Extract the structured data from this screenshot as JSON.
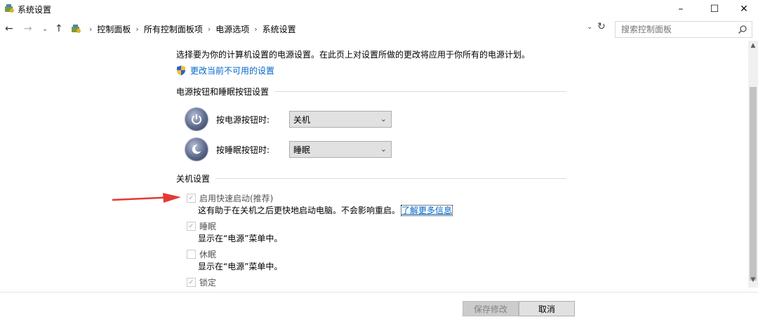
{
  "window": {
    "title": "系统设置",
    "minimize": "–",
    "maximize": "☐",
    "close": "✕"
  },
  "nav": {
    "back": "←",
    "forward": "→",
    "recent": "⌄",
    "up": "↑",
    "breadcrumbs": [
      "控制面板",
      "所有控制面板项",
      "电源选项",
      "系统设置"
    ],
    "dropdown": "⌄",
    "refresh": "↻"
  },
  "search": {
    "placeholder": "搜索控制面板"
  },
  "content": {
    "intro": "选择要为你的计算机设置的电源设置。在此页上对设置所做的更改将应用于你所有的电源计划。",
    "change_link": "更改当前不可用的设置",
    "power_section": {
      "title": "电源按钮和睡眠按钮设置",
      "power_button": {
        "label": "按电源按钮时:",
        "value": "关机"
      },
      "sleep_button": {
        "label": "按睡眠按钮时:",
        "value": "睡眠"
      }
    },
    "shutdown_section": {
      "title": "关机设置",
      "items": [
        {
          "label": "启用快速启动(推荐)",
          "checked": true,
          "desc": "这有助于在关机之后更快地启动电脑。不会影响重启。",
          "link": "了解更多信息"
        },
        {
          "label": "睡眠",
          "checked": true,
          "desc": "显示在“电源”菜单中。"
        },
        {
          "label": "休眠",
          "checked": false,
          "desc": "显示在“电源”菜单中。"
        },
        {
          "label": "锁定",
          "checked": true
        }
      ]
    }
  },
  "footer": {
    "save": "保存修改",
    "cancel": "取消"
  },
  "colors": {
    "link": "#0066cc",
    "arrow": "#e53935"
  }
}
